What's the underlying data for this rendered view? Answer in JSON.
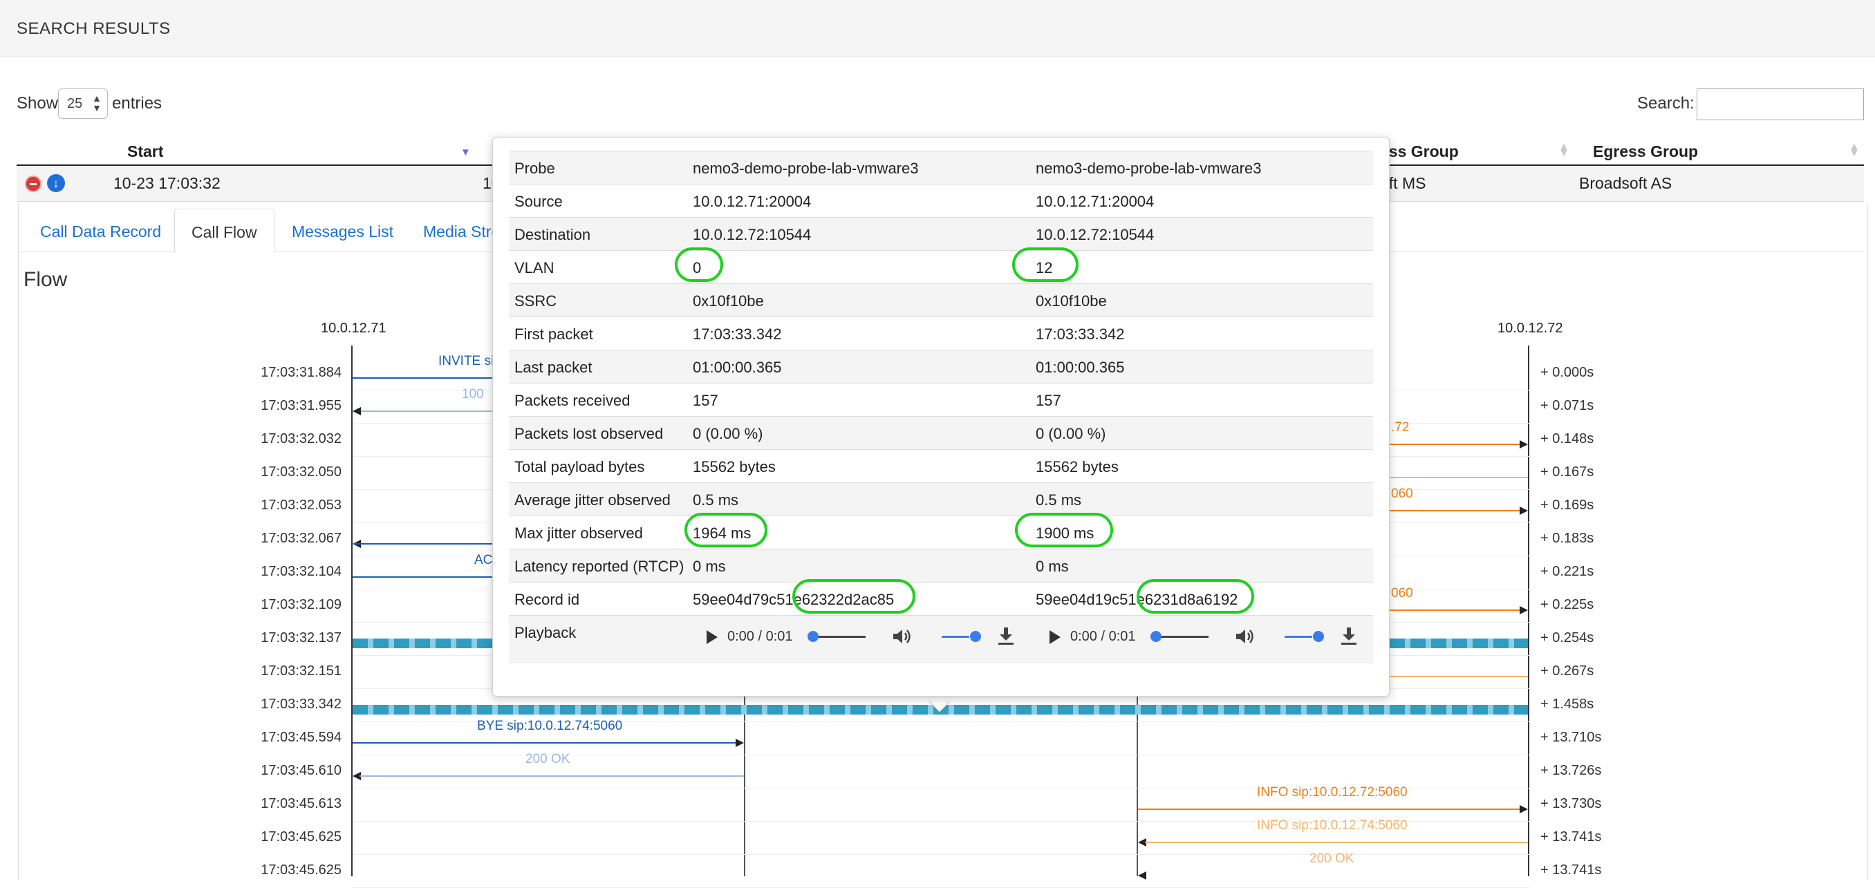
{
  "header": {
    "title": "SEARCH RESULTS"
  },
  "controls": {
    "show_label": "Show",
    "page_size": "25",
    "entries_label": "entries",
    "search_label": "Search:",
    "search_value": ""
  },
  "table": {
    "columns": {
      "start": "Start",
      "ingress_group_partial": "ess Group",
      "egress_group": "Egress Group"
    },
    "row": {
      "start": "10-23 17:03:32",
      "col2_partial": "10",
      "ingress_group_partial": "oft MS",
      "egress_group": "Broadsoft AS"
    }
  },
  "tabs": [
    {
      "label": "Call Data Record"
    },
    {
      "label": "Call Flow"
    },
    {
      "label": "Messages List"
    },
    {
      "label": "Media Stre"
    }
  ],
  "flow": {
    "title": "Flow",
    "hosts": {
      "left": "10.0.12.71",
      "right": "10.0.12.72"
    },
    "timestamps": [
      "17:03:31.884",
      "17:03:31.955",
      "17:03:32.032",
      "17:03:32.050",
      "17:03:32.053",
      "17:03:32.067",
      "17:03:32.104",
      "17:03:32.109",
      "17:03:32.137",
      "17:03:32.151",
      "17:03:33.342",
      "17:03:45.594",
      "17:03:45.610",
      "17:03:45.613",
      "17:03:45.625",
      "17:03:45.625"
    ],
    "deltas": [
      "+ 0.000s",
      "+ 0.071s",
      "+ 0.148s",
      "+ 0.167s",
      "+ 0.169s",
      "+ 0.183s",
      "+ 0.221s",
      "+ 0.225s",
      "+ 0.254s",
      "+ 0.267s",
      "+ 1.458s",
      "+ 13.710s",
      "+ 13.726s",
      "+ 13.730s",
      "+ 13.741s",
      "+ 13.741s"
    ],
    "messages": {
      "invite": "INVITE si",
      "trying": "100",
      "ack": "AC",
      "bye": "BYE sip:10.0.12.74:5060",
      "ok_bye": "200 OK",
      "right_72": ".72",
      "right_060a": "060",
      "right_060b": "060",
      "info1": "INFO sip:10.0.12.72:5060",
      "info2": "INFO sip:10.0.12.74:5060",
      "ok_info": "200 OK"
    },
    "colors": {
      "blue": "#1a5fb4",
      "light_blue": "#9ab9e4",
      "orange": "#f07e12",
      "light_orange": "#f7b36b",
      "stream": "#2f9cc0"
    }
  },
  "popup": {
    "rows": [
      {
        "label": "Probe",
        "a": "nemo3-demo-probe-lab-vmware3",
        "b": "nemo3-demo-probe-lab-vmware3"
      },
      {
        "label": "Source",
        "a": "10.0.12.71:20004",
        "b": "10.0.12.71:20004"
      },
      {
        "label": "Destination",
        "a": "10.0.12.72:10544",
        "b": "10.0.12.72:10544"
      },
      {
        "label": "VLAN",
        "a": "0",
        "b": "12"
      },
      {
        "label": "SSRC",
        "a": "0x10f10be",
        "b": "0x10f10be"
      },
      {
        "label": "First packet",
        "a": "17:03:33.342",
        "b": "17:03:33.342"
      },
      {
        "label": "Last packet",
        "a": "01:00:00.365",
        "b": "01:00:00.365"
      },
      {
        "label": "Packets received",
        "a": "157",
        "b": "157"
      },
      {
        "label": "Packets lost observed",
        "a": "0 (0.00 %)",
        "b": "0 (0.00 %)"
      },
      {
        "label": "Total payload bytes",
        "a": "15562 bytes",
        "b": "15562 bytes"
      },
      {
        "label": "Average jitter observed",
        "a": "0.5 ms",
        "b": "0.5 ms"
      },
      {
        "label": "Max jitter observed",
        "a": "1964 ms",
        "b": "1900 ms"
      },
      {
        "label": "Latency reported (RTCP)",
        "a": "0 ms",
        "b": "0 ms"
      },
      {
        "label": "Record id",
        "a": "59ee04d79c51e62322d2ac85",
        "b": "59ee04d19c51e6231d8a6192"
      }
    ],
    "playback": {
      "label": "Playback",
      "a_time": "0:00 / 0:01",
      "b_time": "0:00 / 0:01",
      "progress": 0,
      "volume": 0.85
    },
    "highlight_color": "#1fd11f"
  }
}
